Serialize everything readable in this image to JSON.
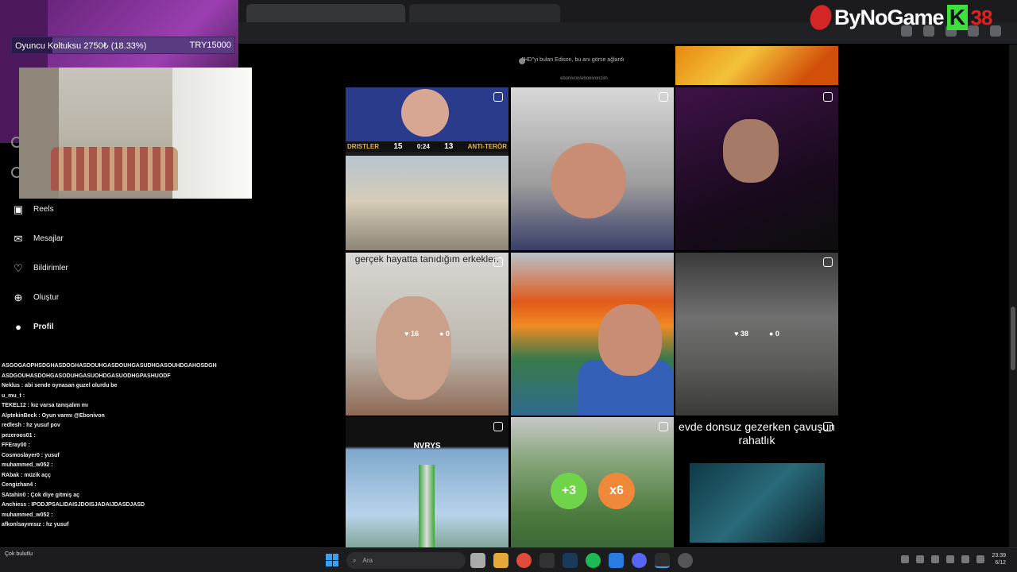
{
  "donation": {
    "label": "Oyuncu Koltuksu 2750₺ (18.33%)",
    "goal": "TRY15000",
    "progress_pct": 18.33
  },
  "brand": {
    "name": "ByNoGame",
    "k": "K",
    "number": "38"
  },
  "ig_nav": [
    {
      "label": "Reels",
      "icon": "reels-icon"
    },
    {
      "label": "Mesajlar",
      "icon": "messages-icon"
    },
    {
      "label": "Bildirimler",
      "icon": "heart-icon"
    },
    {
      "label": "Oluştur",
      "icon": "create-icon"
    },
    {
      "label": "Profil",
      "icon": "profile-icon"
    }
  ],
  "chat": [
    "ASGOGAOPHSDGHASDOGHASDOUHGASDOUHGASUDHGASOUHDGAHOSDGH",
    "ASDGOUHASDOHGASODUHGASUOHDGASUODHGPASHUODF",
    "Neklus : abi sende oynasan guzel olurdu be",
    "u_mu_t :",
    "TEKEL12 : kız varsa tanışalım mı",
    "AlptekinBeck : Oyun varmı @Ebonivon",
    "redlesh : hz yusuf pov",
    "pezeroos01 :",
    "FFEray00 :",
    "Cosmoslayer0 : yusuf",
    "muhammed_w052 :",
    "RAbak : müzik açç",
    "Cengizhan4 :",
    "SAtahin0 : Çok diye gitmiş aç",
    "Anchiess : IPODJPSALIDAISJDOISJADAIJDASDJASD",
    "muhammed_w052 :",
    "afkonlsayımsız : hz yusuf"
  ],
  "top_caption": "\"HD\"yi bulan Edison, bu anı görse ağlardı",
  "top_caption_sub": "ebonivon/ebonivonzim",
  "tiles": {
    "t1": {
      "team_left": "DRISTLER",
      "score_left": "15",
      "time": "0:24",
      "score_right": "13",
      "team_right": "ANTI-TERÖR"
    },
    "t4": {
      "caption": "gerçek hayatta tanıdığım erkekler:",
      "likes": "16",
      "comments": "0"
    },
    "t6": {
      "likes": "38",
      "comments": "0"
    },
    "t7": {
      "caption": "NVRYS"
    },
    "t8": {
      "b1": "+3",
      "b2": "x6"
    },
    "t9": {
      "caption": "evde donsuz gezerken çavuşun rahatlık"
    }
  },
  "taskbar": {
    "search_placeholder": "Ara",
    "time": "23:39",
    "date": "6/12",
    "weather": "Çok bulutlu"
  }
}
